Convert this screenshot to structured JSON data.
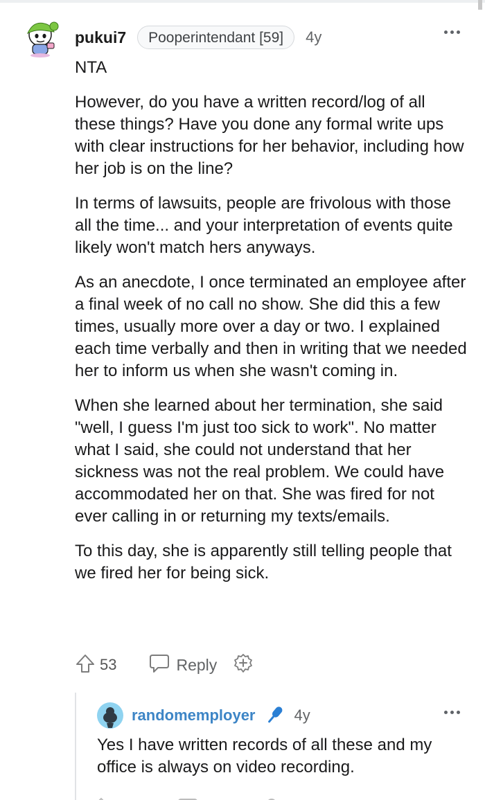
{
  "comment": {
    "username": "pukui7",
    "flair": "Pooperintendant [59]",
    "age": "4y",
    "paragraphs": [
      "NTA",
      "However, do you have a written record/log of all these things? Have you done any formal write ups with clear instructions for her behavior, including how her job is on the line?",
      "In terms of lawsuits, people are frivolous with those all the time... and your interpretation of events quite likely won't match hers anyways.",
      "As an anecdote, I once terminated an employee after a final week of no call no show. She did this a few times, usually more over a day or two. I explained each time verbally and then in writing that we needed her to inform us when she wasn't coming in.",
      "When she learned about her termination, she said \"well, I guess I'm just too sick to work\". No matter what I said, she could not understand that her sickness was not the real problem. We could have accommodated her on that. She was fired for not ever calling in or returning my texts/emails.",
      "To this day, she is apparently still telling people that we fired her for being sick."
    ],
    "upvotes": "53",
    "reply_label": "Reply",
    "icons": [
      "avatar",
      "more-options-icon",
      "upvote-icon",
      "reply-icon",
      "award-icon"
    ]
  },
  "reply": {
    "username": "randomemployer",
    "age": "4y",
    "text": "Yes I have written records of all these and my office is always on video recording.",
    "icons": [
      "avatar",
      "mic-icon",
      "more-options-icon"
    ]
  },
  "colors": {
    "username_reply": "#3d85c6",
    "mic": "#2a7fd4",
    "text": "#1a1a1b",
    "muted": "#626466"
  }
}
